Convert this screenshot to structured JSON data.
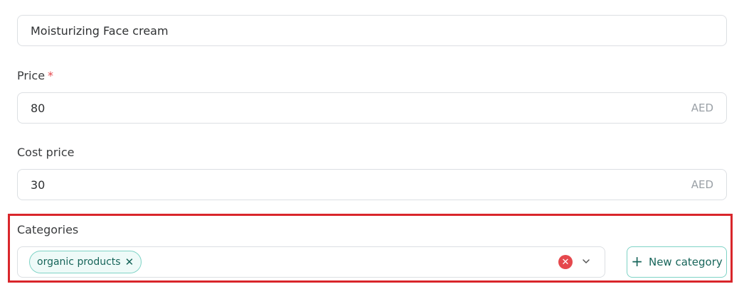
{
  "form": {
    "name": {
      "value": "Moisturizing Face cream"
    },
    "price": {
      "label": "Price",
      "required_mark": "*",
      "value": "80",
      "currency": "AED"
    },
    "cost_price": {
      "label": "Cost price",
      "value": "30",
      "currency": "AED"
    },
    "categories": {
      "label": "Categories",
      "selected": [
        {
          "label": "organic products",
          "remove_icon": "close-icon"
        }
      ],
      "clear_icon": "clear-circle-icon",
      "dropdown_icon": "chevron-down-icon",
      "new_button_label": "New category",
      "new_button_icon": "plus-icon"
    }
  },
  "colors": {
    "highlight": "#d9262b",
    "chip_border": "#7fd3c6",
    "chip_text": "#17655a",
    "required": "#e5484d",
    "clear": "#e5484d"
  }
}
